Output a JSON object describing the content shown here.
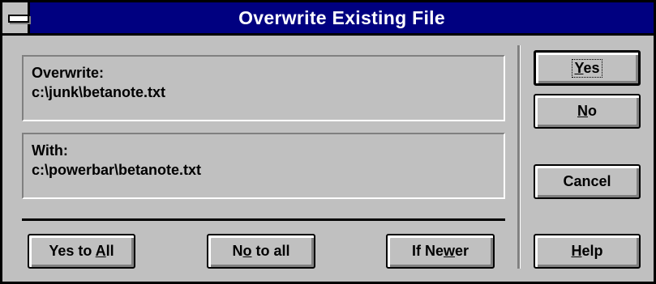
{
  "window": {
    "title": "Overwrite Existing File"
  },
  "overwrite_group": {
    "label": "Overwrite:",
    "path": "c:\\junk\\betanote.txt"
  },
  "with_group": {
    "label": "With:",
    "path": "c:\\powerbar\\betanote.txt"
  },
  "buttons": {
    "yes": {
      "pre": "",
      "key": "Y",
      "post": "es"
    },
    "no": {
      "pre": "",
      "key": "N",
      "post": "o"
    },
    "cancel": {
      "label": "Cancel"
    },
    "help": {
      "pre": "",
      "key": "H",
      "post": "elp"
    },
    "yes_to_all": {
      "pre": "Yes to ",
      "key": "A",
      "post": "ll"
    },
    "no_to_all": {
      "pre": "N",
      "key": "o",
      "post": " to all"
    },
    "if_newer": {
      "pre": "If Ne",
      "key": "w",
      "post": "er"
    }
  }
}
